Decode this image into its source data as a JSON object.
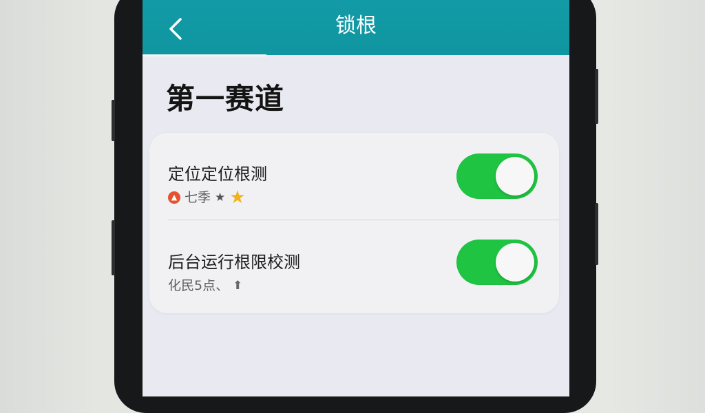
{
  "header": {
    "title": "锁根"
  },
  "page": {
    "section_title": "第一赛道"
  },
  "settings": [
    {
      "label": "定位定位根测",
      "subtitle": "七季",
      "enabled": true
    },
    {
      "label": "后台运行根限校测",
      "subtitle": "化民5点、",
      "enabled": true
    }
  ],
  "icons": {
    "back": "chevron-left-icon",
    "row1_badge": "location-badge-icon",
    "row1_star_small": "star-icon",
    "row1_star_big": "star-icon",
    "row2_arrow": "arrow-up-icon"
  },
  "colors": {
    "app_bar": "#129aa6",
    "toggle_on": "#1fc542",
    "star": "#f2b21b",
    "badge": "#e5522f"
  }
}
